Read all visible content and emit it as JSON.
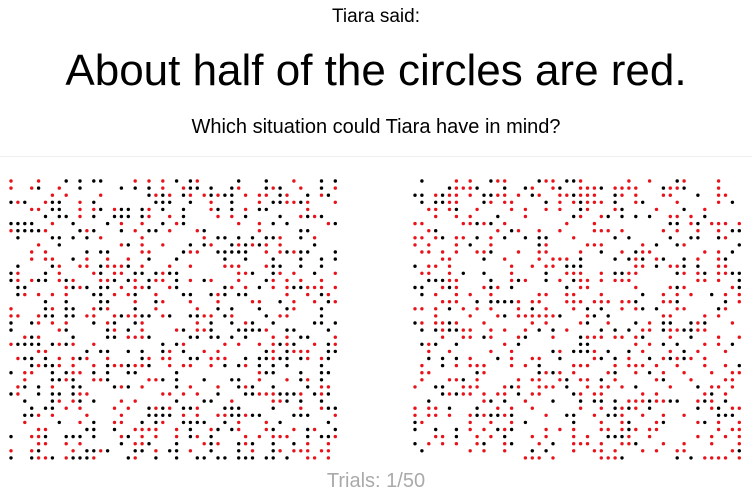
{
  "header": {
    "speaker_line": "Tiara said:",
    "utterance": "About half of the circles are red.",
    "question": "Which situation could Tiara have in mind?"
  },
  "options": [
    {
      "id": "left",
      "red_proportion": 0.5
    },
    {
      "id": "right",
      "red_proportion": 0.65
    }
  ],
  "colors": {
    "red_dot": "#e8131a",
    "black_dot": "#000000",
    "divider": "#eeeeee",
    "trials_text": "#aaaaaa"
  },
  "footer": {
    "trials_label": "Trials: 1/50"
  }
}
